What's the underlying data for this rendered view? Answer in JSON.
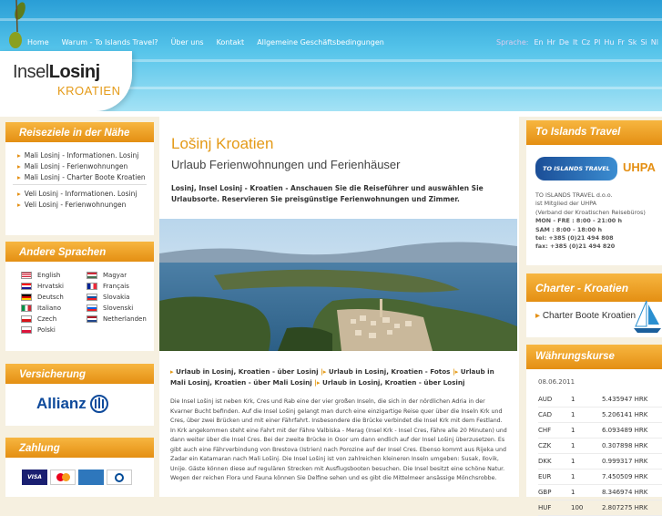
{
  "header": {
    "nav": [
      "Home",
      "Warum - To Islands Travel?",
      "Über uns",
      "Kontakt",
      "Allgemeine Geschäftsbedingungen"
    ],
    "lang_label": "Sprache:",
    "langs": [
      "En",
      "Hr",
      "De",
      "It",
      "Cz",
      "Pl",
      "Hu",
      "Fr",
      "Sk",
      "Si",
      "Nl"
    ],
    "logo_a": "Insel",
    "logo_b": "Losinj",
    "logo_c": "KROATIEN"
  },
  "left": {
    "box1": {
      "title": "Reiseziele in der Nähe",
      "items": [
        "Mali Losinj - Informationen. Losinj",
        "Mali Losinj - Ferienwohnungen",
        "Mali Losinj - Charter Boote Kroatien",
        "Veli Losinj - Informationen. Losinj",
        "Veli Losinj - Ferienwohnungen"
      ]
    },
    "box2": {
      "title": "Andere Sprachen",
      "langs": [
        "English",
        "Magyar",
        "Hrvatski",
        "Français",
        "Deutsch",
        "Slovakia",
        "Italiano",
        "Slovenski",
        "Czech",
        "Netherlanden",
        "Polski"
      ]
    },
    "box3": {
      "title": "Versicherung",
      "brand": "Allianz"
    },
    "box4": {
      "title": "Zahlung",
      "cards": [
        "VISA",
        "MasterCard",
        "American Express",
        "Diners Club"
      ]
    }
  },
  "main": {
    "title": "Lošinj Kroatien",
    "subtitle": "Urlaub Ferienwohnungen und Ferienhäuser",
    "intro": "Losinj, Insel Losinj - Kroatien - Anschauen Sie die Reiseführer und auswählen Sie Urlaubsorte. Reservieren Sie preisgünstige Ferienwohnungen und Zimmer.",
    "links": [
      "Urlaub in Losinj, Kroatien - über Losinj",
      "Urlaub in Losinj, Kroatien - Fotos",
      "Urlaub in Mali Losinj, Kroatien - über Mali Losinj",
      "Urlaub in Losinj, Kroatien - über Losinj"
    ],
    "body": "Die Insel Lošinj ist neben Krk, Cres und Rab eine der vier großen Inseln, die sich in der nördlichen Adria in der Kvarner Bucht befinden. Auf die Insel Lošinj gelangt man durch eine einzigartige Reise quer über die Inseln Krk und Cres, über zwei Brücken und mit einer Fährfahrt. Insbesondere die Brücke verbindet die Insel Krk mit dem Festland. In Krk angekommen steht eine Fahrt mit der Fähre Valbiska - Merag (Insel Krk - Insel Cres, Fähre alle 20 Minuten) und dann weiter über die Insel Cres. Bei der zweite Brücke in Osor um dann endlich auf der Insel Lošinj überzusetzen. Es gibt auch eine Fährverbindung von Brestova (Istrien) nach Porozine auf der Insel Cres. Ebenso kommt aus Rijeka und Zadar ein Katamaran nach Mali Lošinj. Die Insel Lošinj ist von zahlreichen kleineren Inseln umgeben: Susak, Ilovik, Unije. Gäste können diese auf regulären Strecken mit Ausflugsbooten besuchen. Die Insel besitzt eine schöne Natur. Wegen der reichen Flora und Fauna können Sie Delfine sehen und es gibt die Mittelmeer ansässige Mönchsrobbe."
  },
  "right": {
    "travel": {
      "title": "To Islands Travel",
      "logo": "TO ISLANDS TRAVEL",
      "badge": "UHPA",
      "lines": [
        "TO ISLANDS TRAVEL d.o.o.",
        "ist Mitglied der UHPA",
        "(Verband der Kroatischen Reisebüros)",
        "MON - FRE : 8:00 - 21:00 h",
        "SAM : 8:00 - 18:00 h",
        "tel: +385 (0)21 494 808",
        "fax: +385 (0)21 494 820"
      ]
    },
    "charter": {
      "title": "Charter - Kroatien",
      "item": "Charter Boote Kroatien"
    },
    "currency": {
      "title": "Währungskurse",
      "date": "08.06.2011",
      "rows": [
        [
          "AUD",
          "1",
          "5.435947 HRK"
        ],
        [
          "CAD",
          "1",
          "5.206141 HRK"
        ],
        [
          "CHF",
          "1",
          "6.093489 HRK"
        ],
        [
          "CZK",
          "1",
          "0.307898 HRK"
        ],
        [
          "DKK",
          "1",
          "0.999317 HRK"
        ],
        [
          "EUR",
          "1",
          "7.450509 HRK"
        ],
        [
          "GBP",
          "1",
          "8.346974 HRK"
        ],
        [
          "HUF",
          "100",
          "2.807275 HRK"
        ]
      ]
    }
  }
}
